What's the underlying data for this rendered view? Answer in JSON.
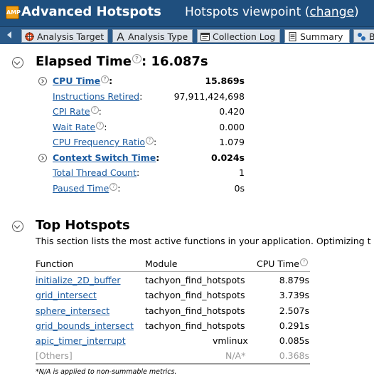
{
  "header": {
    "app_icon_text": "AMP",
    "title": "Advanced Hotspots",
    "viewpoint_text": "Hotspots viewpoint (",
    "change_label": "change",
    "viewpoint_close": ")"
  },
  "tabs": [
    {
      "label": "Analysis Target",
      "icon": "target-icon"
    },
    {
      "label": "Analysis Type",
      "icon": "analysis-type-icon"
    },
    {
      "label": "Collection Log",
      "icon": "log-icon"
    },
    {
      "label": "Summary",
      "icon": "summary-icon",
      "active": true
    },
    {
      "label": "B",
      "icon": "bottom-up-icon"
    }
  ],
  "elapsed": {
    "title_label": "Elapsed Time",
    "title_value": ": 16.087s",
    "metrics": [
      {
        "label": "CPU Time",
        "value": "15.869s",
        "bold": true,
        "expandable": true
      },
      {
        "label": "Instructions Retired",
        "value": "97,911,424,698"
      },
      {
        "label": "CPI Rate",
        "value": "0.420",
        "help": true
      },
      {
        "label": "Wait Rate",
        "value": "0.000",
        "help": true
      },
      {
        "label": "CPU Frequency Ratio",
        "value": "1.079",
        "help": true
      },
      {
        "label": "Context Switch Time",
        "value": "0.024s",
        "bold": true,
        "expandable": true
      },
      {
        "label": "Total Thread Count",
        "value": "1"
      },
      {
        "label": "Paused Time",
        "value": "0s",
        "help": true
      }
    ]
  },
  "hotspots": {
    "title": "Top Hotspots",
    "description": "This section lists the most active functions in your application. Optimizing t",
    "columns": [
      "Function",
      "Module",
      "CPU Time"
    ],
    "rows": [
      {
        "function": "initialize_2D_buffer",
        "module": "tachyon_find_hotspots",
        "cpu": "8.879s"
      },
      {
        "function": "grid_intersect",
        "module": "tachyon_find_hotspots",
        "cpu": "3.739s"
      },
      {
        "function": "sphere_intersect",
        "module": "tachyon_find_hotspots",
        "cpu": "2.507s"
      },
      {
        "function": "grid_bounds_intersect",
        "module": "tachyon_find_hotspots",
        "cpu": "0.291s"
      },
      {
        "function": "apic_timer_interrupt",
        "module": "vmlinux",
        "cpu": "0.085s"
      }
    ],
    "others": {
      "function": "[Others]",
      "module": "N/A*",
      "cpu": "0.368s"
    },
    "footnote": "*N/A is applied to non-summable metrics."
  },
  "colors": {
    "header_bg": "#1f4f7e",
    "link": "#1a5aa0"
  }
}
